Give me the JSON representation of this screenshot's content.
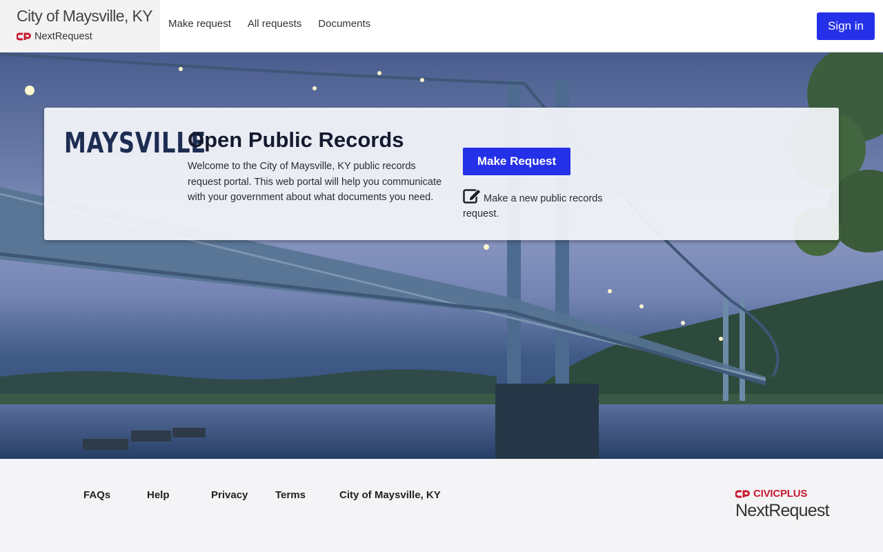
{
  "header": {
    "site_title": "City of Maysville, KY",
    "product_name": "NextRequest",
    "nav": [
      "Make request",
      "All requests",
      "Documents"
    ],
    "sign_in_label": "Sign in"
  },
  "hero": {
    "logo_text": "MAYSVILLE",
    "title": "Open Public Records",
    "description": "Welcome to the City of Maysville, KY public records request portal. This web portal will help you communicate with your government about what documents you need.",
    "cta_label": "Make Request",
    "cta_hint": "Make a new public records request."
  },
  "footer": {
    "links": [
      "FAQs",
      "Help",
      "Privacy",
      "Terms",
      "City of Maysville, KY"
    ],
    "vendor_brand": "CIVICPLUS",
    "vendor_product": "NextRequest"
  },
  "colors": {
    "accent": "#2531e8",
    "brand_red": "#c8192e",
    "logo_navy": "#1d2d52"
  },
  "icons": {
    "brand_mark": "civicplus-cp-icon",
    "edit": "edit-icon"
  }
}
